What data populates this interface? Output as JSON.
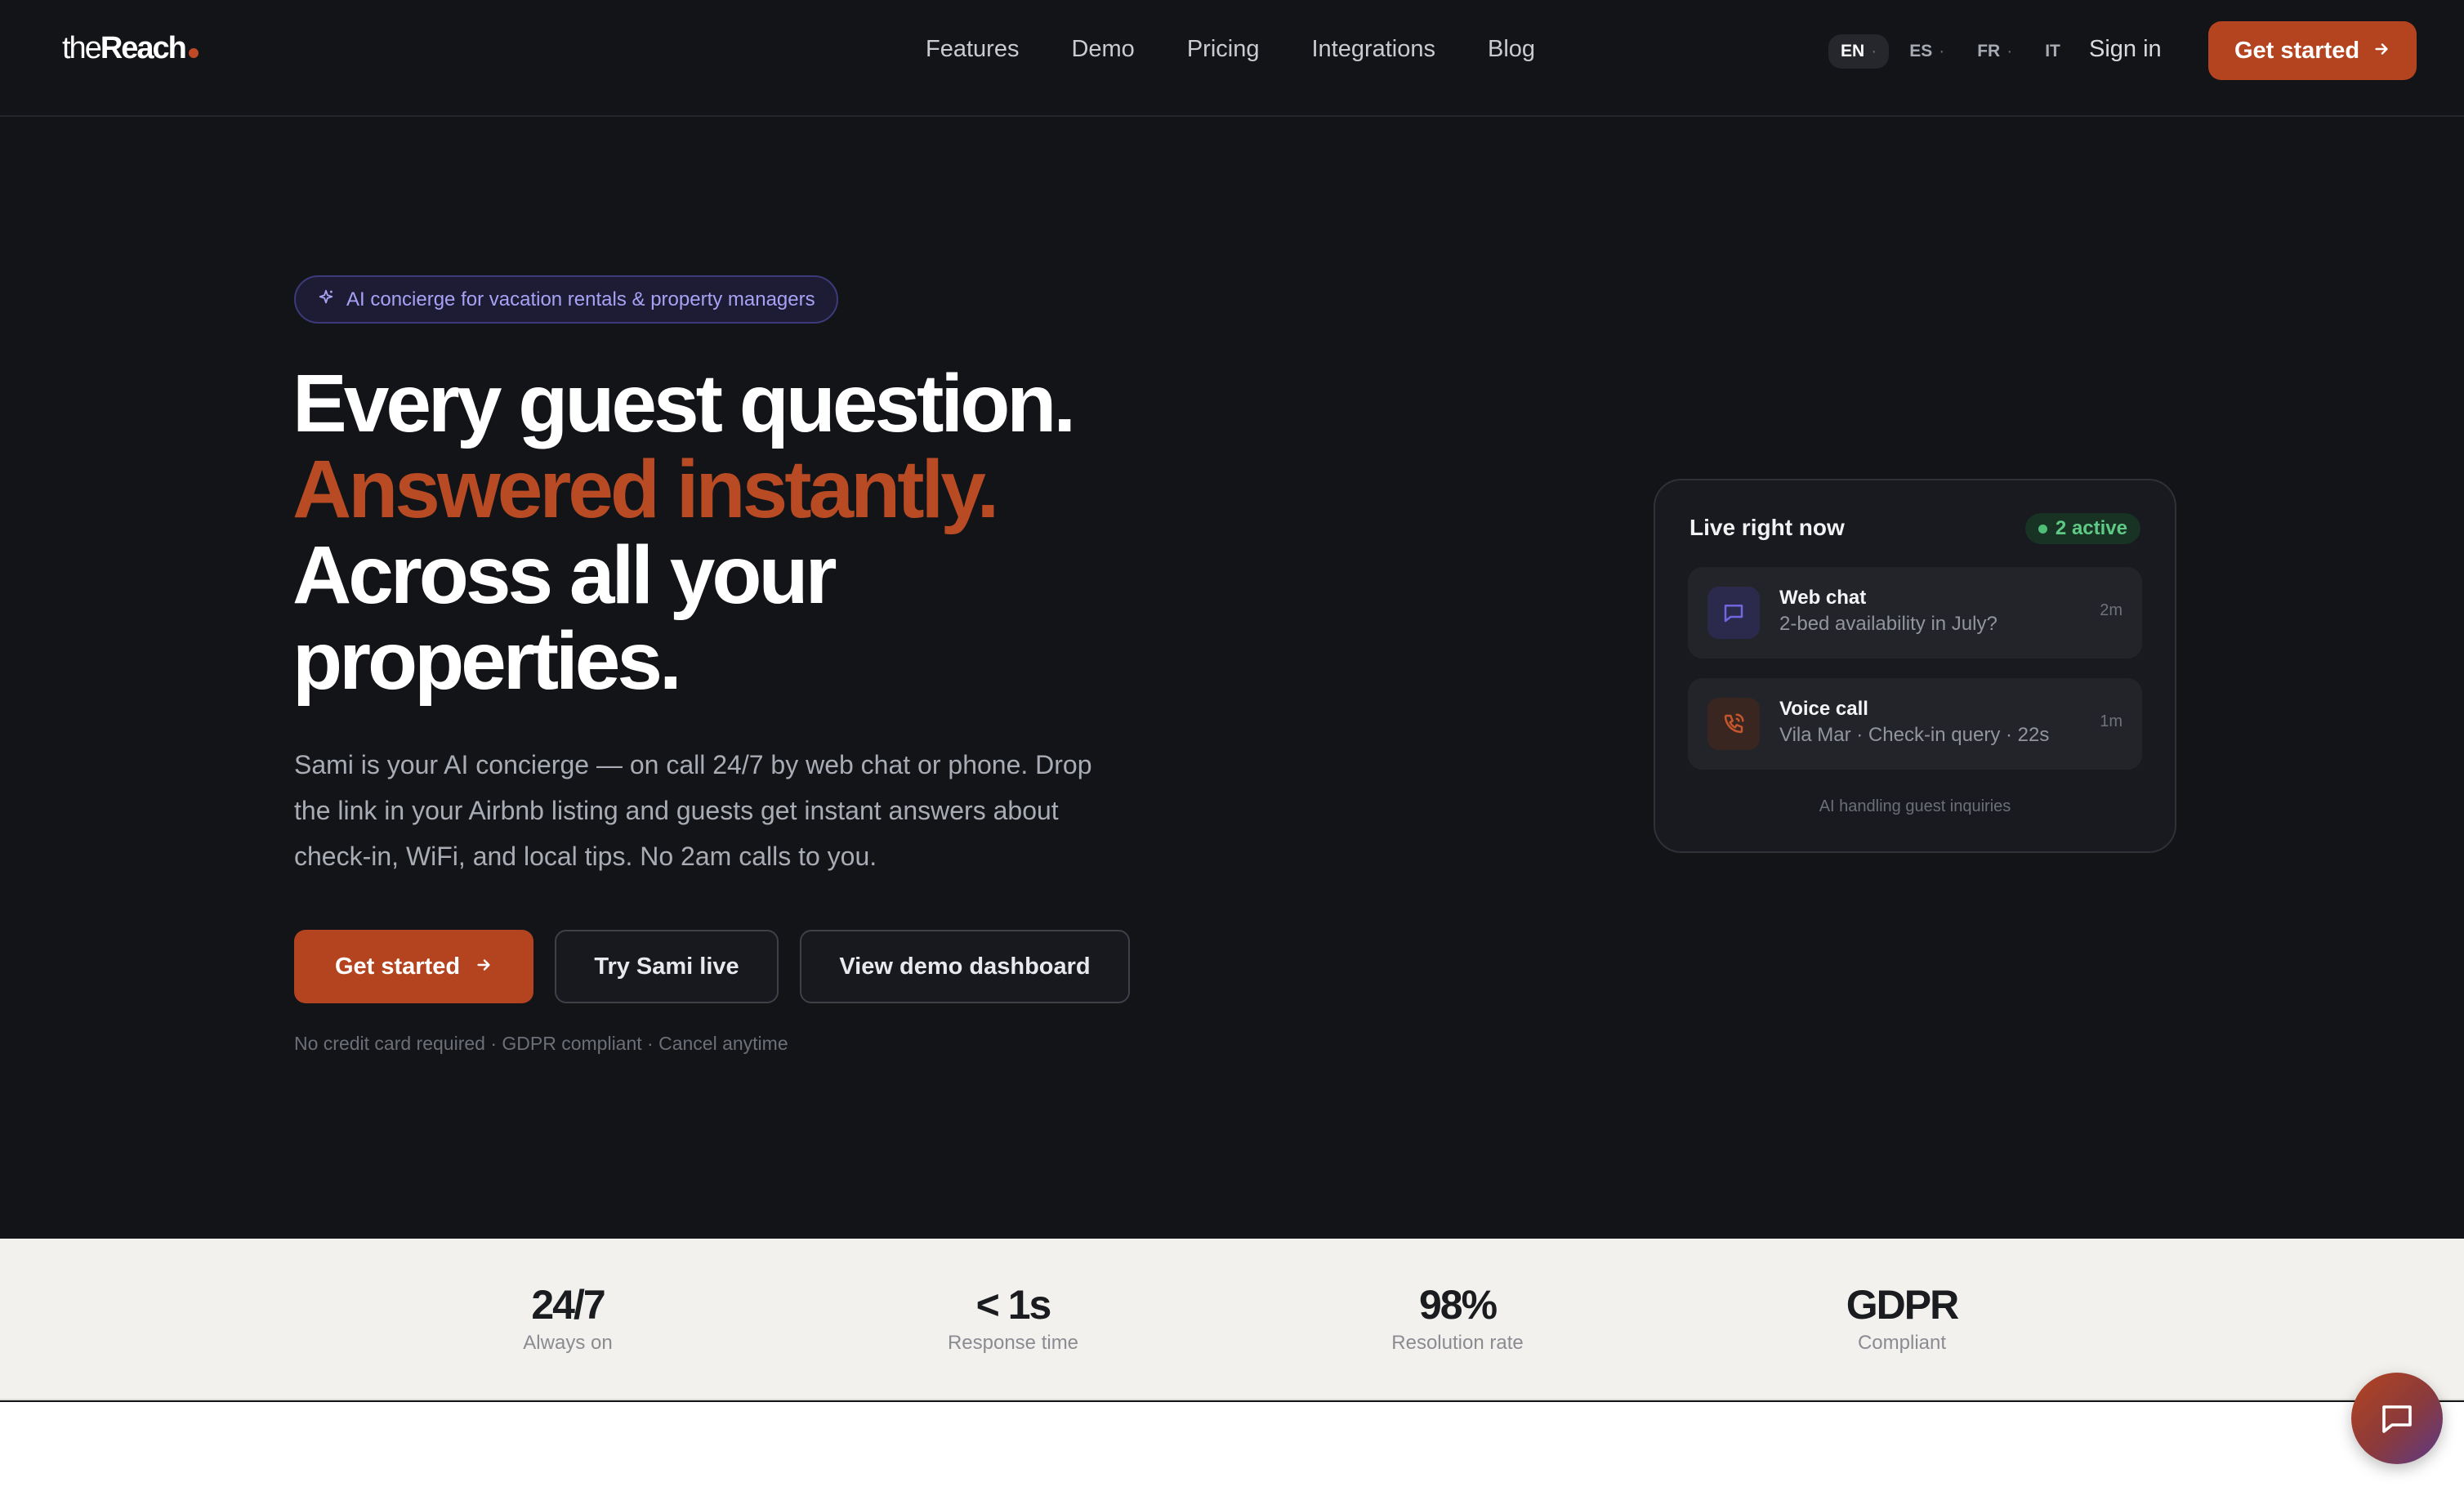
{
  "brand": {
    "logo_light": "the",
    "logo_bold": "Reach"
  },
  "nav": {
    "items": [
      "Features",
      "Demo",
      "Pricing",
      "Integrations",
      "Blog"
    ]
  },
  "languages": {
    "items": [
      "EN",
      "ES",
      "FR",
      "IT"
    ],
    "active": "EN",
    "separator": "·"
  },
  "header": {
    "signin": "Sign in",
    "cta": "Get started"
  },
  "hero": {
    "pill": "AI concierge for vacation rentals & property managers",
    "line1": "Every guest question.",
    "line2": "Answered instantly.",
    "line3": "Across all your",
    "line4": "properties.",
    "lede": "Sami is your AI concierge — on call 24/7 by web chat or phone. Drop the link in your Airbnb listing and guests get instant answers about check-in, WiFi, and local tips. No 2am calls to you.",
    "cta_primary": "Get started",
    "cta_try": "Try Sami live",
    "cta_demo": "View demo dashboard",
    "fineprint": "No credit card required · GDPR compliant · Cancel anytime"
  },
  "live_card": {
    "title": "Live right now",
    "badge": "2 active",
    "rows": [
      {
        "title": "Web chat",
        "subtitle": "2-bed availability in July?",
        "time": "2m",
        "icon": "chat-icon"
      },
      {
        "title": "Voice call",
        "subtitle": "Vila Mar · Check-in query · 22s",
        "time": "1m",
        "icon": "phone-icon"
      }
    ],
    "footer": "AI handling guest inquiries"
  },
  "stats": [
    {
      "value": "24/7",
      "label": "Always on"
    },
    {
      "value": "< 1s",
      "label": "Response time"
    },
    {
      "value": "98%",
      "label": "Resolution rate"
    },
    {
      "value": "GDPR",
      "label": "Compliant"
    }
  ],
  "colors": {
    "background": "#131418",
    "accent": "#b4441f",
    "accent_text": "#b84a24",
    "pill_text": "#a8a2f5",
    "active_green": "#5fc986",
    "stats_band": "#f2f1ed"
  }
}
